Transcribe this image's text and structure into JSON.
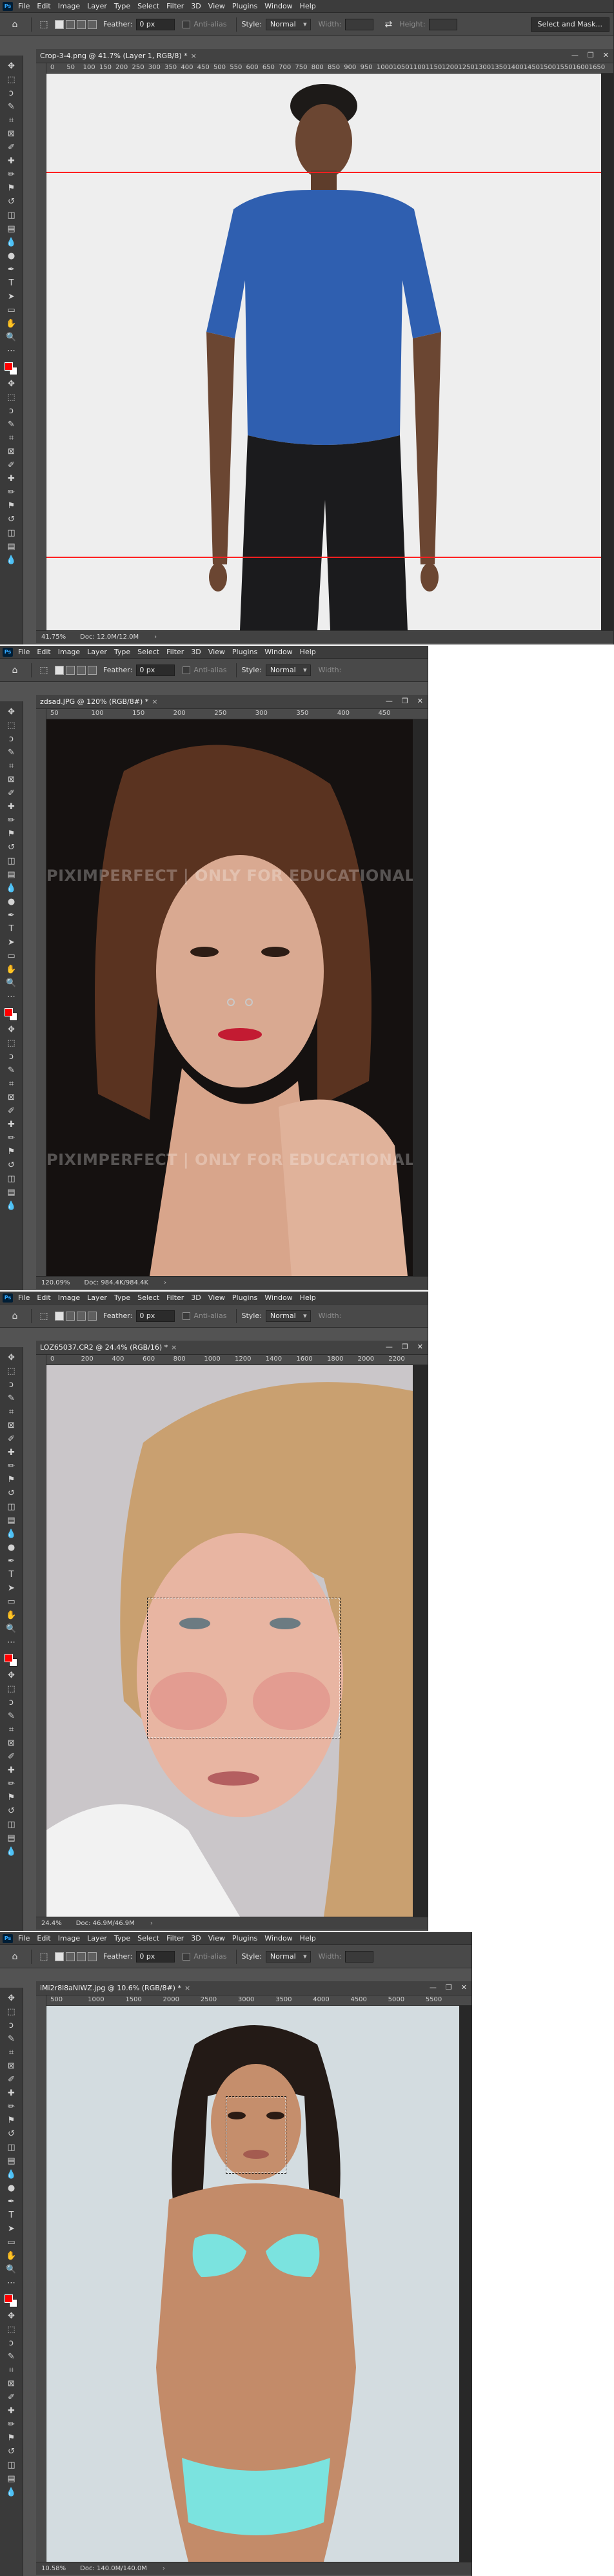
{
  "menu": [
    "File",
    "Edit",
    "Image",
    "Layer",
    "Type",
    "Select",
    "Filter",
    "3D",
    "View",
    "Plugins",
    "Window",
    "Help"
  ],
  "options": {
    "feather_label": "Feather:",
    "feather_value": "0 px",
    "antialias_label": "Anti-alias",
    "style_label": "Style:",
    "style_value": "Normal",
    "width_label": "Width:",
    "height_label": "Height:",
    "select_mask_label": "Select and Mask..."
  },
  "windows": [
    {
      "tab_title": "Crop-3-4.png @ 41.7% (Layer 1, RGB/8) *",
      "ruler": [
        "0",
        "50",
        "100",
        "150",
        "200",
        "250",
        "300",
        "350",
        "400",
        "450",
        "500",
        "550",
        "600",
        "650",
        "700",
        "750",
        "800",
        "850",
        "900",
        "950",
        "1000",
        "1050",
        "1100",
        "1150",
        "1200",
        "1250",
        "1300",
        "1350",
        "1400",
        "1450",
        "1500",
        "1550",
        "1600",
        "1650"
      ],
      "zoom": "41.75%",
      "doc": "Doc: 12.0M/12.0M"
    },
    {
      "tab_title": "zdsad.JPG @ 120% (RGB/8#) *",
      "ruler": [
        "50",
        "100",
        "150",
        "200",
        "250",
        "300",
        "350",
        "400",
        "450"
      ],
      "zoom": "120.09%",
      "doc": "Doc: 984.4K/984.4K",
      "watermark": "PIXIMPERFECT | ONLY FOR EDUCATIONAL PURPOSES"
    },
    {
      "tab_title": "LOZ65037.CR2 @ 24.4% (RGB/16) *",
      "ruler": [
        "0",
        "200",
        "400",
        "600",
        "800",
        "1000",
        "1200",
        "1400",
        "1600",
        "1800",
        "2000",
        "2200"
      ],
      "zoom": "24.4%",
      "doc": "Doc: 46.9M/46.9M"
    },
    {
      "tab_title": "iMi2r8l8aNIWZ.jpg @ 10.6% (RGB/8#) *",
      "ruler": [
        "500",
        "1000",
        "1500",
        "2000",
        "2500",
        "3000",
        "3500",
        "4000",
        "4500",
        "5000",
        "5500"
      ],
      "zoom": "10.58%",
      "doc": "Doc: 140.0M/140.0M"
    }
  ],
  "colors": {
    "foreground": "#ff0000",
    "background": "#ffffff",
    "guide": "#ff2020",
    "app_bg": "#535353"
  }
}
